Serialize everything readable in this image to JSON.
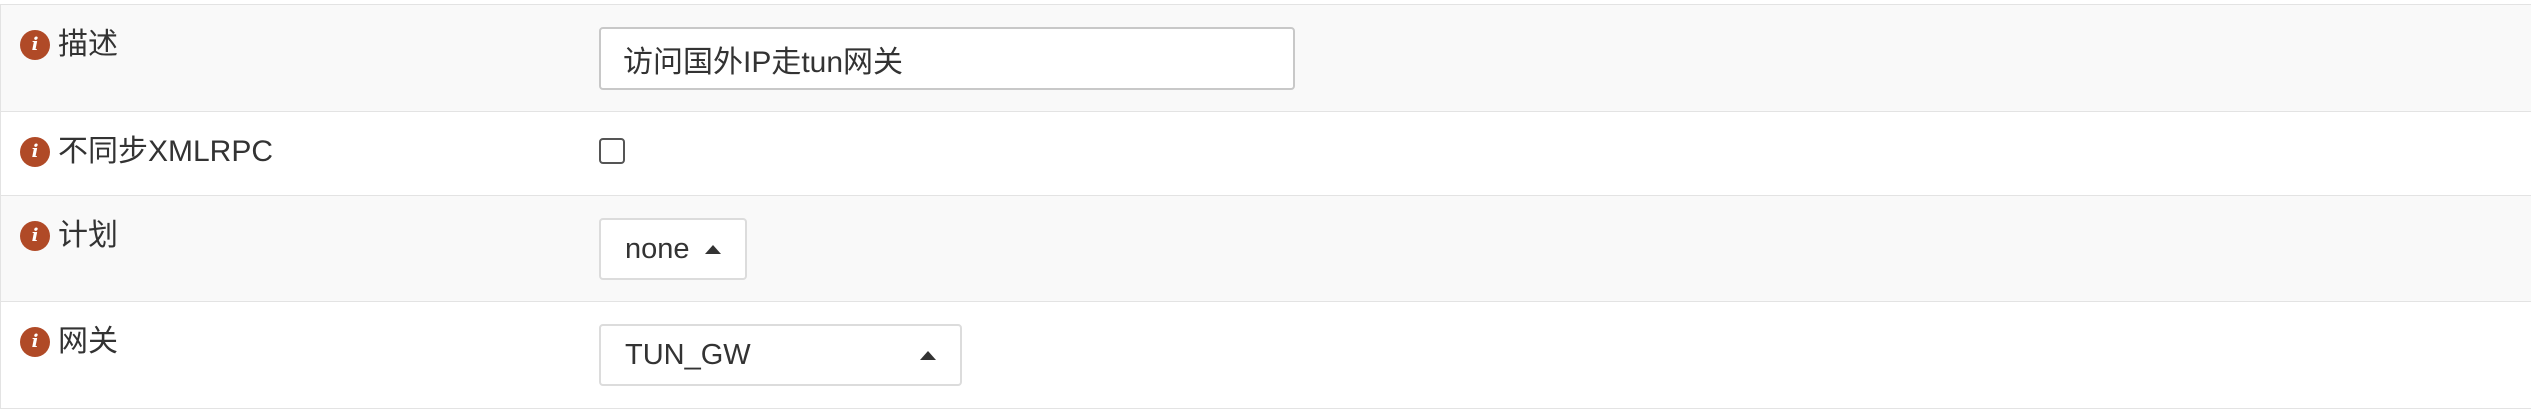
{
  "form": {
    "rows": [
      {
        "label": "描述",
        "value": "访问国外IP走tun网关",
        "info_icon": "info-icon"
      },
      {
        "label": "不同步XMLRPC",
        "checked": false,
        "info_icon": "info-icon"
      },
      {
        "label": "计划",
        "selected": "none",
        "info_icon": "info-icon"
      },
      {
        "label": "网关",
        "selected": "TUN_GW",
        "info_icon": "info-icon"
      }
    ],
    "info_glyph": "i"
  },
  "colors": {
    "info_icon": "#b04a27",
    "row_alt": "#f9f9f9",
    "border": "#e3e3e3"
  }
}
